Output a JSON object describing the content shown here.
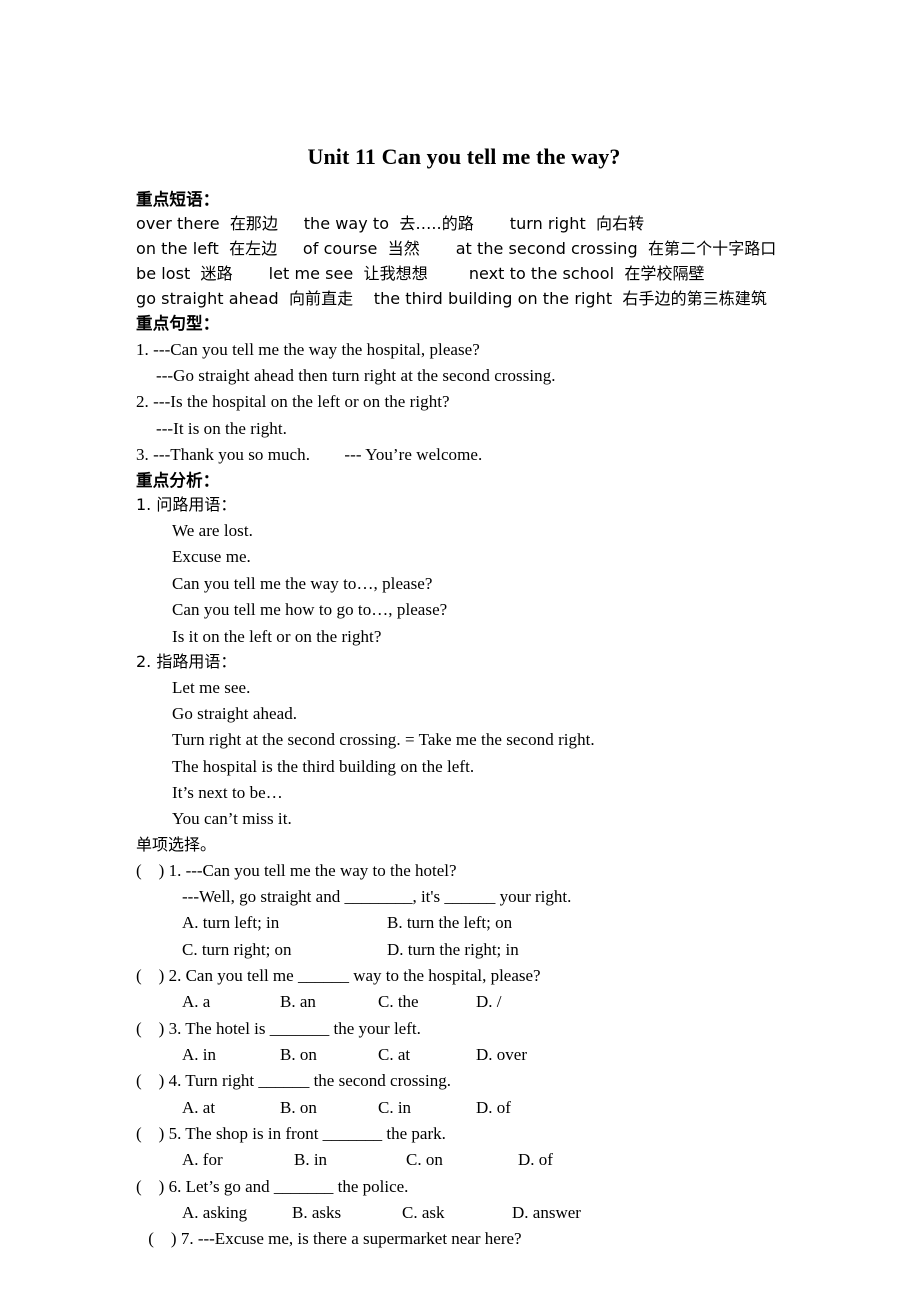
{
  "document": {
    "title": "Unit 11 Can you tell me the way?",
    "sections": {
      "phrases_heading": "重点短语：",
      "phrases_lines": [
        "over there  在那边     the way to  去…..的路       turn right  向右转",
        "on the left  在左边     of course  当然       at the second crossing  在第二个十字路口",
        "be lost  迷路       let me see  让我想想        next to the school  在学校隔壁",
        "go straight ahead  向前直走    the third building on the right  右手边的第三栋建筑"
      ],
      "patterns_heading": "重点句型：",
      "patterns_lines": [
        "1. ---Can you tell me the way the hospital, please?",
        "---Go straight ahead then turn right at the second crossing.",
        "2. ---Is the hospital on the left or on the right?",
        "---It is on the right.",
        "3. ---Thank you so much.        --- You’re welcome."
      ],
      "analysis_heading": "重点分析：",
      "analysis_item1_label": "1.  问路用语：",
      "analysis_item1_lines": [
        "We are lost.",
        "Excuse me.",
        "Can you tell me the way to…, please?",
        "Can you tell me how to go to…, please?",
        "Is it on the left or on the right?"
      ],
      "analysis_item2_label": "2.  指路用语：",
      "analysis_item2_lines": [
        "Let me see.",
        "Go straight ahead.",
        "Turn right at the second crossing. = Take me the second right.",
        "The hospital is the third building on the left.",
        "It’s next to be…",
        "You can’t miss it."
      ],
      "exercise_heading": "单项选择。"
    },
    "questions": [
      {
        "marker": "(    ) 1.",
        "stem": "(    ) 1. ---Can you tell me the way to the hotel?",
        "stem2": "---Well, go straight and ________, it's ______ your right.",
        "layout": "two-col",
        "options": [
          "A. turn left; in",
          "B. turn the left; on",
          "C. turn right; on",
          "D. turn the right; in"
        ]
      },
      {
        "marker": "(    ) 2.",
        "stem": "(    ) 2. Can you tell me ______ way to the hospital, please?",
        "stem2": "",
        "layout": "four-col",
        "options": [
          "A. a",
          "B. an",
          "C. the",
          "D. /"
        ]
      },
      {
        "marker": "(    ) 3.",
        "stem": "(    ) 3. The hotel is _______ the your left.",
        "stem2": "",
        "layout": "four-col",
        "options": [
          "A. in",
          "B. on",
          "C. at",
          "D. over"
        ]
      },
      {
        "marker": "(    ) 4.",
        "stem": "(    ) 4. Turn right ______ the second crossing.",
        "stem2": "",
        "layout": "four-col",
        "options": [
          "A. at",
          "B. on",
          "C. in",
          "D. of"
        ]
      },
      {
        "marker": "(    ) 5.",
        "stem": "(    ) 5. The shop is in front _______ the park.",
        "stem2": "",
        "layout": "four-col-wide",
        "options": [
          "A. for",
          "B. in",
          "C. on",
          "D. of"
        ]
      },
      {
        "marker": "(    ) 6.",
        "stem": "(    ) 6. Let’s go and _______ the police.",
        "stem2": "",
        "layout": "four-col-wide2",
        "options": [
          "A. asking",
          "B. asks",
          "C. ask",
          "D. answer"
        ]
      },
      {
        "marker": "(    ) 7.",
        "stem": " (    ) 7. ---Excuse me, is there a supermarket near here?",
        "stem2": "",
        "layout": "none",
        "options": []
      }
    ]
  }
}
